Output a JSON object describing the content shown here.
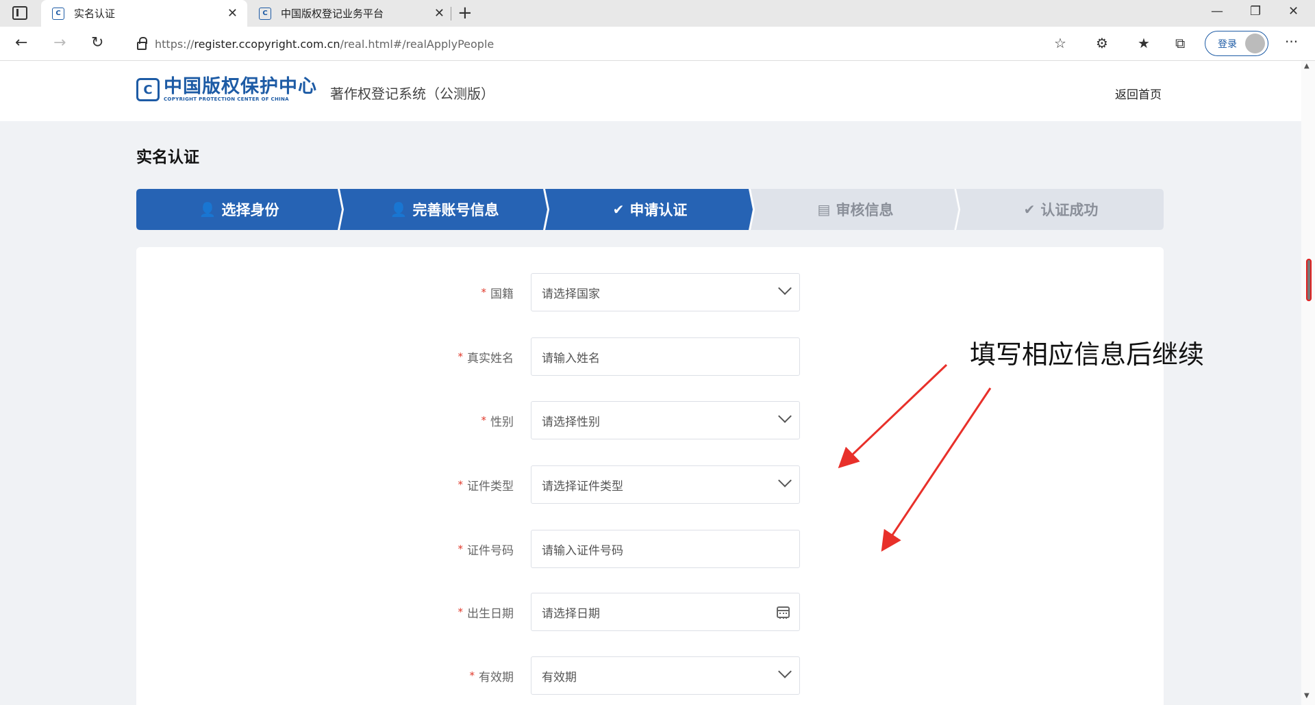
{
  "browser": {
    "tabs": [
      {
        "title": "实名认证",
        "favicon": "C",
        "active": true
      },
      {
        "title": "中国版权登记业务平台",
        "favicon": "C",
        "active": false
      }
    ],
    "url_prefix": "https://",
    "url_host": "register.ccopyright.com.cn",
    "url_path": "/real.html#/realApplyPeople",
    "login_label": "登录"
  },
  "header": {
    "logo_mark": "C",
    "logo_cn": "中国版权保护中心",
    "logo_en": "COPYRIGHT PROTECTION CENTER OF CHINA",
    "system_name": "著作权登记系统（公测版）",
    "home_link": "返回首页"
  },
  "page_title": "实名认证",
  "steps": [
    {
      "label": "选择身份",
      "icon": "user-icon",
      "glyph": "👤",
      "state": "done"
    },
    {
      "label": "完善账号信息",
      "icon": "user-edit-icon",
      "glyph": "👤",
      "state": "done"
    },
    {
      "label": "申请认证",
      "icon": "shield-check-icon",
      "glyph": "✔",
      "state": "done"
    },
    {
      "label": "审核信息",
      "icon": "document-icon",
      "glyph": "▤",
      "state": "todo"
    },
    {
      "label": "认证成功",
      "icon": "check-circle-icon",
      "glyph": "✔",
      "state": "todo"
    }
  ],
  "form": {
    "required_mark": "*",
    "fields": [
      {
        "label": "国籍",
        "placeholder": "请选择国家",
        "kind": "select"
      },
      {
        "label": "真实姓名",
        "placeholder": "请输入姓名",
        "kind": "input"
      },
      {
        "label": "性别",
        "placeholder": "请选择性别",
        "kind": "select"
      },
      {
        "label": "证件类型",
        "placeholder": "请选择证件类型",
        "kind": "select"
      },
      {
        "label": "证件号码",
        "placeholder": "请输入证件号码",
        "kind": "input"
      },
      {
        "label": "出生日期",
        "placeholder": "请选择日期",
        "kind": "date"
      },
      {
        "label": "有效期",
        "placeholder": "有效期",
        "kind": "select"
      }
    ]
  },
  "annotation": {
    "text": "填写相应信息后继续",
    "color": "#e8302a"
  },
  "colors": {
    "brand": "#1d5ba5",
    "step_done": "#2663b4",
    "step_todo": "#dfe3ea",
    "required": "#e0392b"
  }
}
